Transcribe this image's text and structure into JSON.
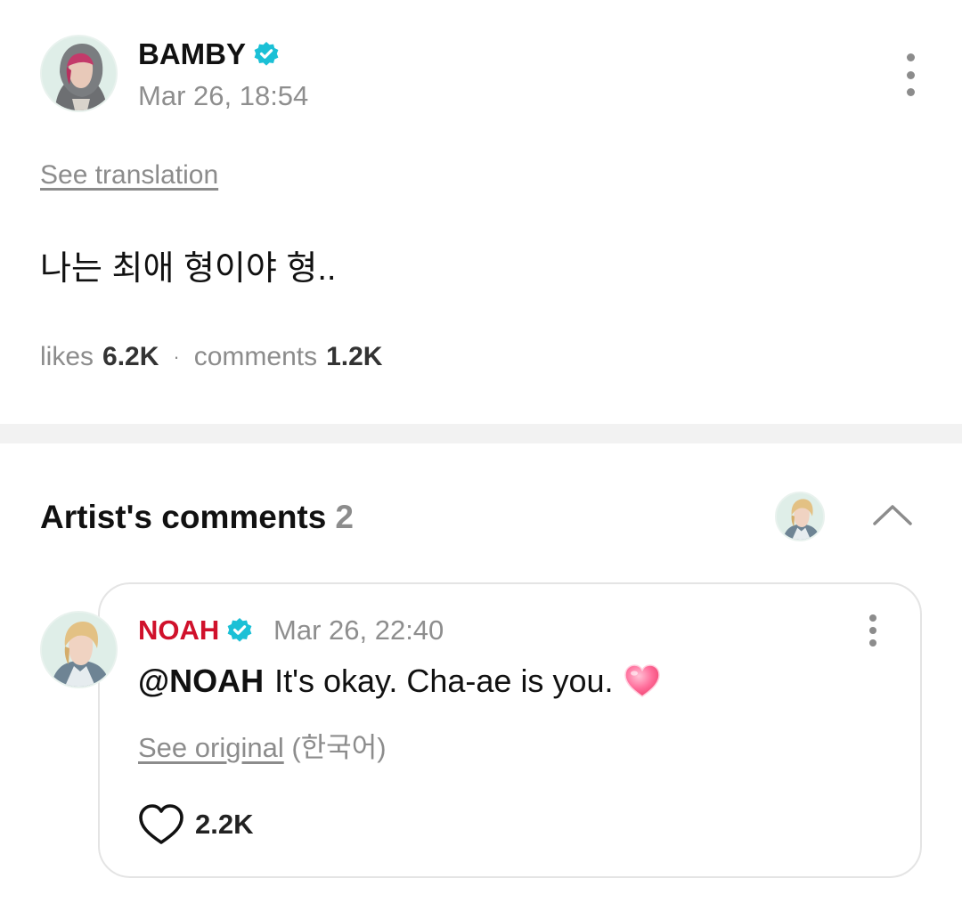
{
  "post": {
    "author": "BAMBY",
    "time": "Mar 26, 18:54",
    "see_translation": "See translation",
    "body": "나는 최애 형이야 형..",
    "likes_label": "likes",
    "likes_count": "6.2K",
    "separator": "·",
    "comments_label": "comments",
    "comments_count": "1.2K"
  },
  "artist_comments": {
    "title": "Artist's comments",
    "count": "2"
  },
  "comment": {
    "author": "NOAH",
    "time": "Mar 26, 22:40",
    "mention": "@NOAH",
    "text": "It's okay. Cha-ae is you.",
    "see_original_link": "See original",
    "see_original_lang": "(한국어)",
    "likes": "2.2K"
  },
  "colors": {
    "verified": "#1bc0d6",
    "artist_name": "#d0112b",
    "muted_text": "#8c8c8c"
  },
  "icons": {
    "verified": "verified-badge-icon",
    "more": "more-vertical-icon",
    "collapse": "chevron-up-icon",
    "like": "heart-outline-icon",
    "emoji": "pink-heart-emoji"
  }
}
